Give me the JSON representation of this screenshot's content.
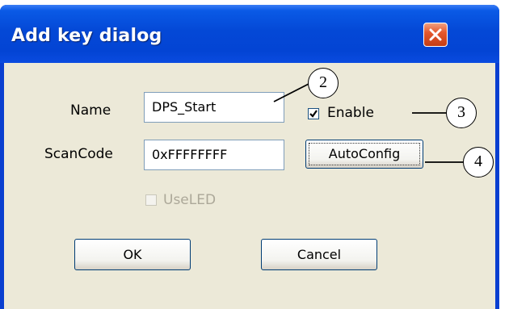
{
  "dialog": {
    "title": "Add key dialog",
    "close_icon": "close-x-icon"
  },
  "form": {
    "name_label": "Name",
    "name_value": "DPS_Start",
    "scancode_label": "ScanCode",
    "scancode_value": "0xFFFFFFFF",
    "enable_label": "Enable",
    "enable_checked": true,
    "useled_label": "UseLED",
    "useled_checked": false,
    "useled_disabled": true
  },
  "buttons": {
    "autoconfig": "AutoConfig",
    "ok": "OK",
    "cancel": "Cancel"
  },
  "callouts": [
    "2",
    "3",
    "4"
  ],
  "colors": {
    "titlebar": "#0448d6",
    "client_bg": "#ece9d8",
    "close_button": "#e5582e"
  }
}
